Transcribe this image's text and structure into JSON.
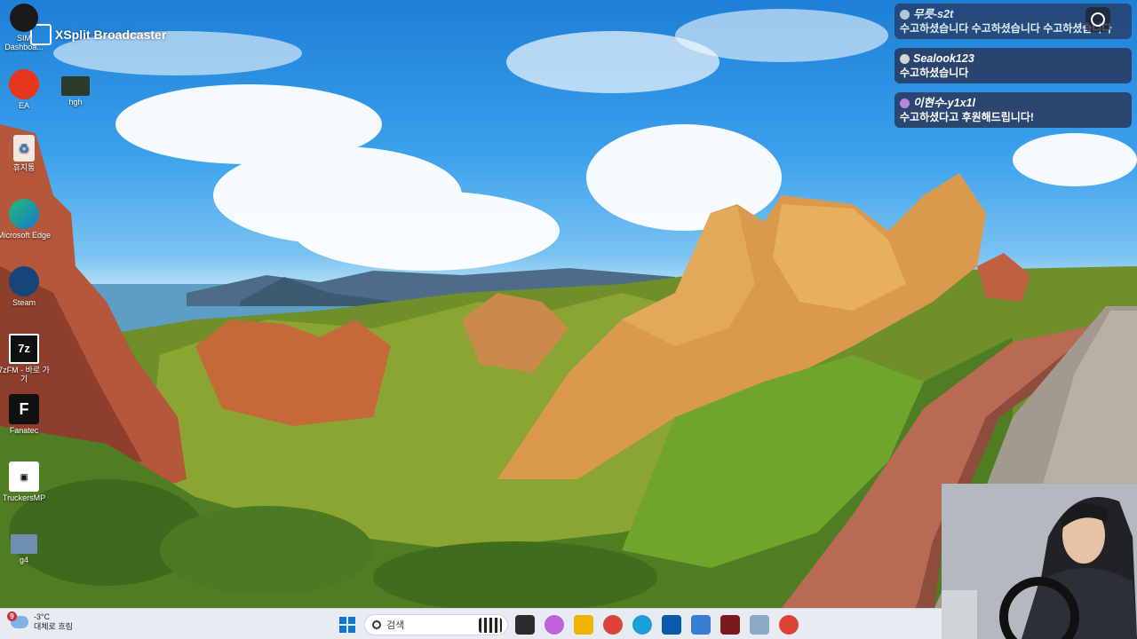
{
  "overlay": {
    "app_title": "XSplit Broadcaster"
  },
  "desktop_icons": [
    {
      "label": "SIM Dashboa...",
      "icon": "sim-dashboard-icon"
    },
    {
      "label": "EA",
      "icon": "ea-icon"
    },
    {
      "label": "hgh",
      "icon": "hgh-icon"
    },
    {
      "label": "휴지통",
      "icon": "recycle-bin-icon"
    },
    {
      "label": "Microsoft Edge",
      "icon": "edge-icon"
    },
    {
      "label": "Steam",
      "icon": "steam-icon"
    },
    {
      "label": "7zFM - 바로 가기",
      "icon": "7zip-icon"
    },
    {
      "label": "Fanatec",
      "icon": "fanatec-icon"
    },
    {
      "label": "TruckersMP",
      "icon": "truckersmp-icon"
    },
    {
      "label": "g4",
      "icon": "g4-icon"
    }
  ],
  "chat": {
    "messages": [
      {
        "user": "무릇-s2t",
        "text": "수고하셨습니다 수고하셨습니다 수고하셨습니다"
      },
      {
        "user": "Sealook123",
        "text": "수고하셨습니다"
      },
      {
        "user": "이현수-y1x1l",
        "text": "수고하셨다고 후원해드립니다!"
      }
    ]
  },
  "taskbar": {
    "weather": {
      "badge": "9",
      "temp": "-3°C",
      "desc": "대체로 흐림"
    },
    "search_placeholder": "검색",
    "apps": [
      {
        "icon": "task-view-icon",
        "color": "#2b2b2b"
      },
      {
        "icon": "copilot-icon",
        "color": "#c060e0"
      },
      {
        "icon": "file-explorer-icon",
        "color": "#f0b400"
      },
      {
        "icon": "chrome-icon",
        "color": "#db4437"
      },
      {
        "icon": "edge-taskbar-icon",
        "color": "#1aa0d8"
      },
      {
        "icon": "store-icon",
        "color": "#0a5aa8"
      },
      {
        "icon": "network-app-icon",
        "color": "#3a7bd5"
      },
      {
        "icon": "voicemeeter-icon",
        "color": "#7a1a1a"
      },
      {
        "icon": "photo-app-icon",
        "color": "#8aa8c8"
      },
      {
        "icon": "chrome-2-icon",
        "color": "#db4437"
      }
    ]
  }
}
